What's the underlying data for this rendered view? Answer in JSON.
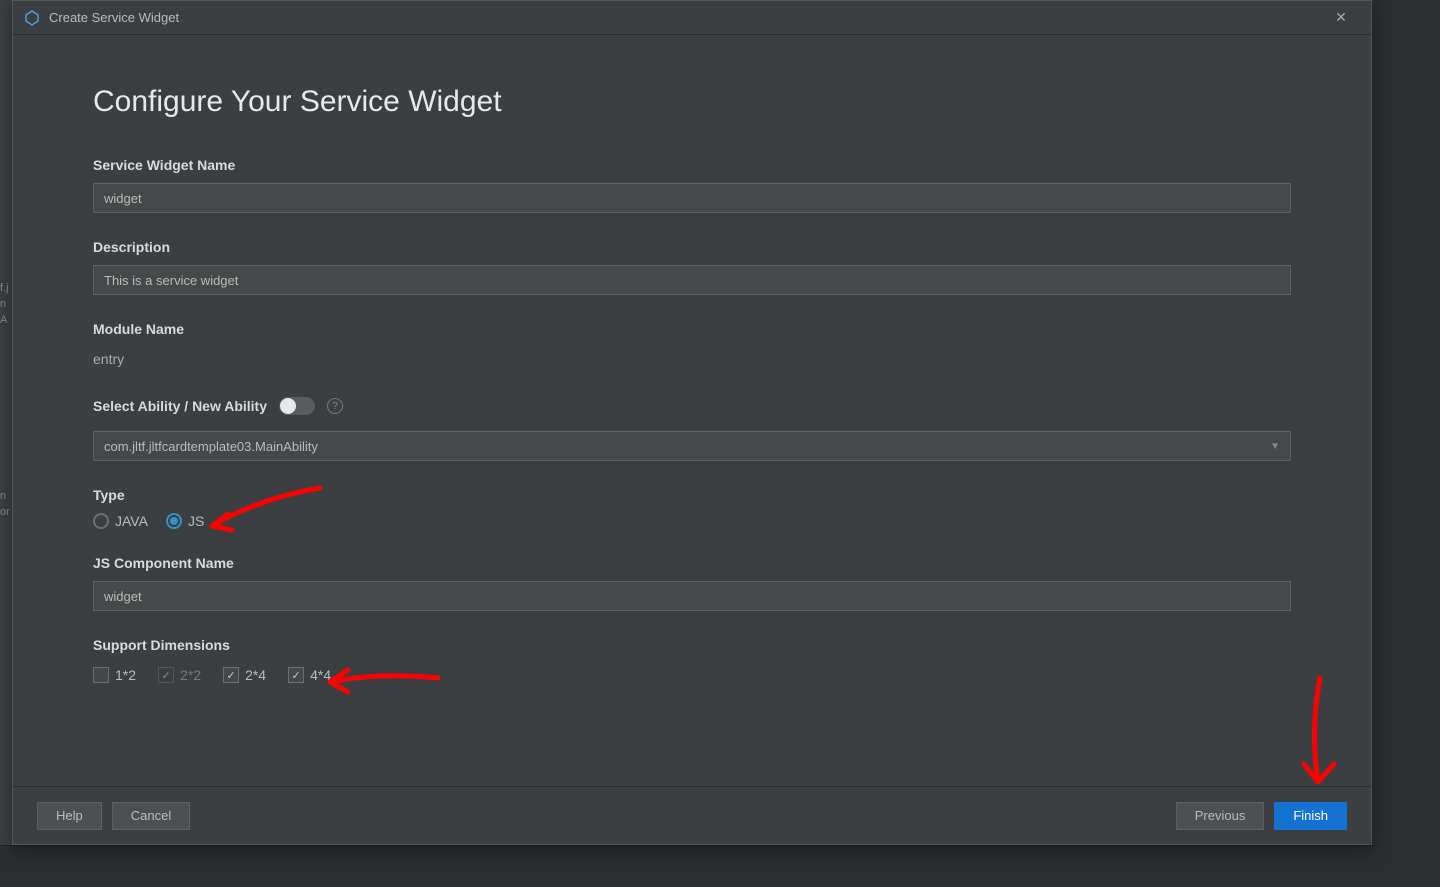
{
  "window": {
    "title": "Create Service Widget"
  },
  "page": {
    "title": "Configure Your Service Widget"
  },
  "fields": {
    "name_label": "Service Widget Name",
    "name_value": "widget",
    "desc_label": "Description",
    "desc_value": "This is a service widget",
    "module_label": "Module Name",
    "module_value": "entry",
    "ability_label": "Select Ability / New Ability",
    "ability_toggle_on": false,
    "ability_value": "com.jltf.jltfcardtemplate03.MainAbility",
    "type_label": "Type",
    "type_options": {
      "java": "JAVA",
      "js": "JS"
    },
    "type_selected": "JS",
    "jscomp_label": "JS Component Name",
    "jscomp_value": "widget",
    "dims_label": "Support Dimensions",
    "dims": [
      {
        "label": "1*2",
        "checked": false,
        "disabled": false
      },
      {
        "label": "2*2",
        "checked": true,
        "disabled": true
      },
      {
        "label": "2*4",
        "checked": true,
        "disabled": false
      },
      {
        "label": "4*4",
        "checked": true,
        "disabled": false
      }
    ]
  },
  "buttons": {
    "help": "Help",
    "cancel": "Cancel",
    "previous": "Previous",
    "finish": "Finish"
  },
  "bg": {
    "items": [
      "f.j",
      "n",
      "A",
      "n",
      "or"
    ]
  },
  "annotations": {
    "color": "#ff0000",
    "arrows": [
      "arrow-to-type-js",
      "arrow-to-dimensions",
      "arrow-to-finish"
    ]
  }
}
